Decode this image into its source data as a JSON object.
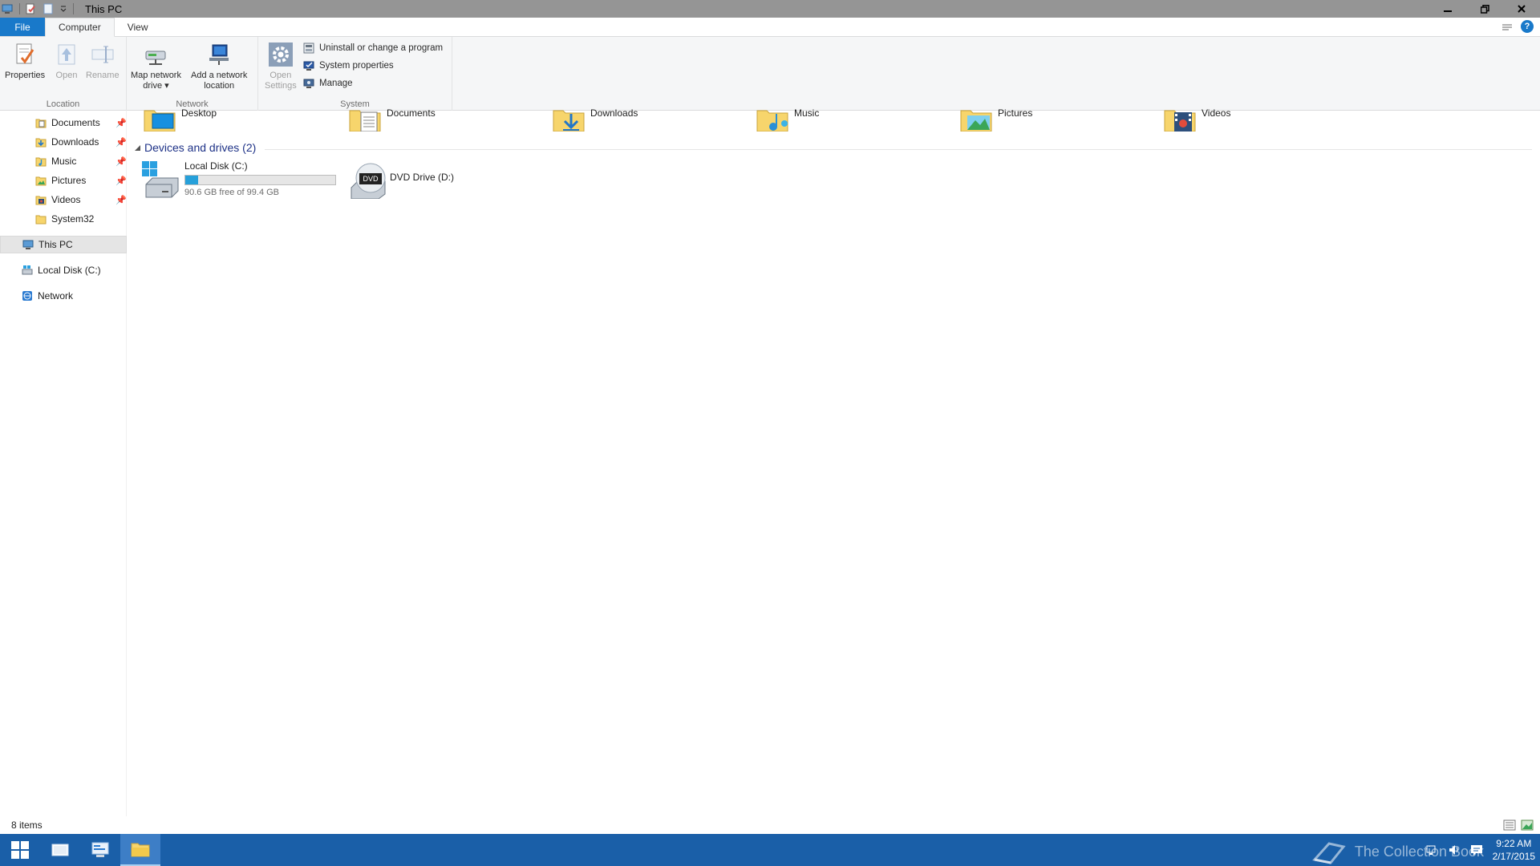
{
  "window": {
    "title": "This PC",
    "controls": {
      "minimize": "–",
      "restore": "❐",
      "close": "✕"
    }
  },
  "ribbon": {
    "tabs": [
      {
        "label": "File"
      },
      {
        "label": "Computer"
      },
      {
        "label": "View"
      }
    ],
    "groups": {
      "location": {
        "label": "Location",
        "properties": "Properties",
        "open": "Open",
        "rename": "Rename"
      },
      "network": {
        "label": "Network",
        "map_network_drive_line1": "Map network",
        "map_network_drive_line2": "drive ▾",
        "add_network_location_line1": "Add a network",
        "add_network_location_line2": "location"
      },
      "system": {
        "label": "System",
        "open_settings_line1": "Open",
        "open_settings_line2": "Settings",
        "uninstall": "Uninstall or change a program",
        "system_properties": "System properties",
        "manage": "Manage"
      }
    }
  },
  "nav": {
    "quick_access": [
      {
        "label": "Documents",
        "icon": "documents-folder-icon",
        "pinned": true
      },
      {
        "label": "Downloads",
        "icon": "downloads-folder-icon",
        "pinned": true
      },
      {
        "label": "Music",
        "icon": "music-folder-icon",
        "pinned": true
      },
      {
        "label": "Pictures",
        "icon": "pictures-folder-icon",
        "pinned": true
      },
      {
        "label": "Videos",
        "icon": "videos-folder-icon",
        "pinned": true
      },
      {
        "label": "System32",
        "icon": "folder-icon",
        "pinned": false
      }
    ],
    "this_pc": "This PC",
    "local_disk": "Local Disk (C:)",
    "network": "Network"
  },
  "content": {
    "folders": [
      {
        "label": "Desktop",
        "icon": "desktop-folder-icon"
      },
      {
        "label": "Documents",
        "icon": "documents-folder-icon"
      },
      {
        "label": "Downloads",
        "icon": "downloads-folder-icon"
      },
      {
        "label": "Music",
        "icon": "music-folder-icon"
      },
      {
        "label": "Pictures",
        "icon": "pictures-folder-icon"
      },
      {
        "label": "Videos",
        "icon": "videos-folder-icon"
      }
    ],
    "devices_header": "Devices and drives (2)",
    "drives": [
      {
        "label": "Local Disk (C:)",
        "free_text": "90.6 GB free of 99.4 GB",
        "used_fraction": 0.088
      },
      {
        "label": "DVD Drive (D:)",
        "badge": "DVD"
      }
    ]
  },
  "status": {
    "items": "8 items"
  },
  "taskbar": {
    "time": "9:22 AM",
    "date": "2/17/2015",
    "watermark": "The Collection Book"
  },
  "colors": {
    "accent": "#1979ca",
    "taskbar": "#1a5fa8",
    "drive_fill": "#26a0da",
    "section_header": "#1e3287"
  }
}
